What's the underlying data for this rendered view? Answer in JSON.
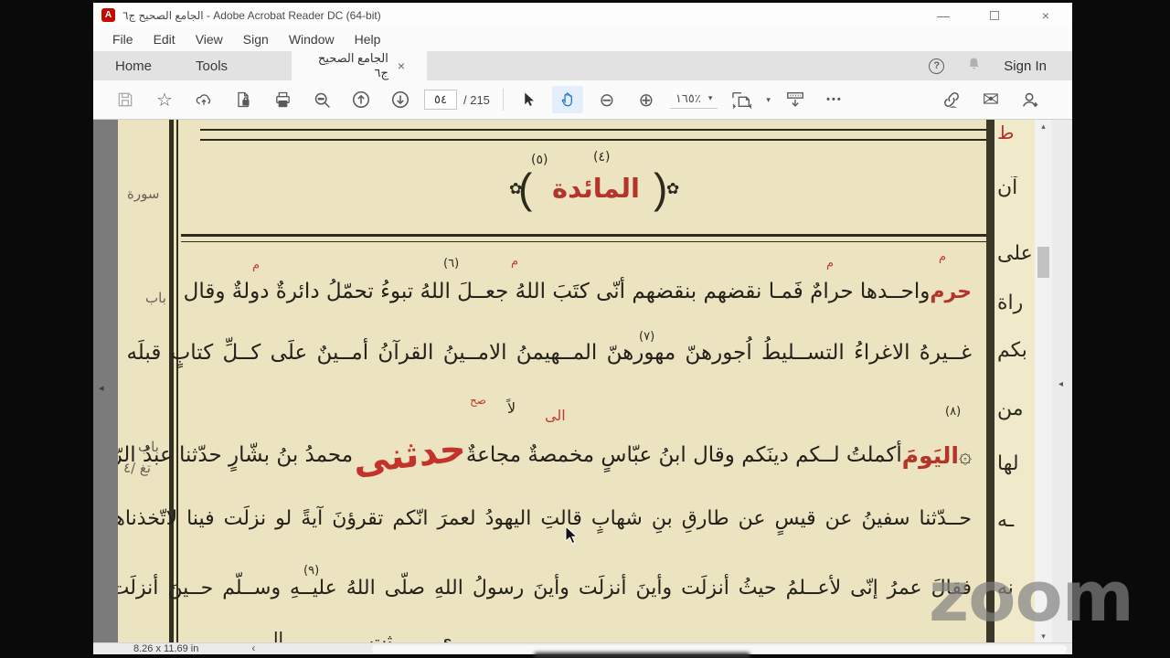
{
  "window": {
    "title": "الجامع الصحيح ج٦ - Adobe Acrobat Reader DC (64-bit)",
    "minimize": "—",
    "close": "×"
  },
  "menu": {
    "file": "File",
    "edit": "Edit",
    "view": "View",
    "sign": "Sign",
    "window": "Window",
    "help": "Help"
  },
  "tabs": {
    "home": "Home",
    "tools": "Tools",
    "doc": "الجامع الصحيح ج٦",
    "close": "×",
    "help_icon": "?",
    "sign_in": "Sign In"
  },
  "toolbar": {
    "star": "☆",
    "zoom_out": "⊖",
    "zoom_in": "⊕",
    "page_current": "٥٤",
    "page_total": "/ 215",
    "zoom_value": "١٦٥٪",
    "chevron": "▾",
    "ellipsis": "•••",
    "envelope": "✉"
  },
  "page": {
    "header": {
      "fn_right": "(٤)",
      "fn_left": "(٥)",
      "title": "المائدة",
      "flower": "✿",
      "paren_left": "(",
      "paren_right": ")"
    },
    "l1": {
      "lead": "حرم",
      "text": "واحــدها حرامٌ فَمـا نقضهم بنقضهم أنّى كتَبَ اللهُ جعــلَ اللهُ تبوءُ تحمّلُ دائرةٌ دولةٌ وقال",
      "fn": "(٦)",
      "marks": [
        "م",
        "م",
        "م",
        "م"
      ]
    },
    "l2": {
      "text": "غــيرهُ الاغراءُ التســليطُ اُجورهنّ مهورهنّ المــهيمنُ الامــينُ القرآنُ أمــينٌ علَى كــلِّ كتابٍ قبلَه",
      "fn": "(٧)"
    },
    "l3": {
      "rosette": "۞",
      "red1": "اليَومَ",
      "black1": "أكملتُ لــكم دينَكم وقال ابنُ عبّاسٍ مخمصةٌ مجاعةٌ",
      "red2": "حدثنى",
      "black2": "محمدُ بنُ بشّارٍ حدّثنا عبدُ الرّحمنِ",
      "fn": "(٨)",
      "mark_sah": "صح",
      "mark_la": "لاً",
      "mark_ila": "الى"
    },
    "l4": {
      "text": "حــدّثنا سفينُ عن قيسٍ عن طارقِ بنِ شهابٍ قالتِ اليهودُ لعمرَ انّكم تقرؤنَ آيةً لو نزلَت فينا لاتّخذناها عيدًا"
    },
    "l5": {
      "text": "فقالَ عمرُ إنّى لأعــلمُ حيثُ أنزلَت وأينَ أنزلَت وأينَ رسولُ اللهِ صلّى اللهُ عليــهِ وســلّم حــينَ أنزلَت يومَ",
      "fn": "(٩)"
    },
    "l6": [
      "اا",
      "ثت",
      "ى"
    ],
    "margin_left": [
      "سورة",
      "باب",
      "باب",
      "تغ /٤"
    ],
    "margin_right": [
      "ط",
      "آن",
      "على",
      "راة",
      "بكم",
      "من",
      "لها",
      "ـه",
      "نه"
    ]
  },
  "scroll": {
    "up": "▴",
    "down": "▾",
    "collapse_left": "◂",
    "collapse_right": "◂",
    "back": "‹"
  },
  "status": {
    "page_size": "8.26 x 11.69 in"
  },
  "watermark": "zoom",
  "colors": {
    "accent_red": "#b5342a",
    "page_bg": "#ece4c0",
    "content_bg": "#7b7b7b",
    "hand_active": "#1a73c9"
  }
}
